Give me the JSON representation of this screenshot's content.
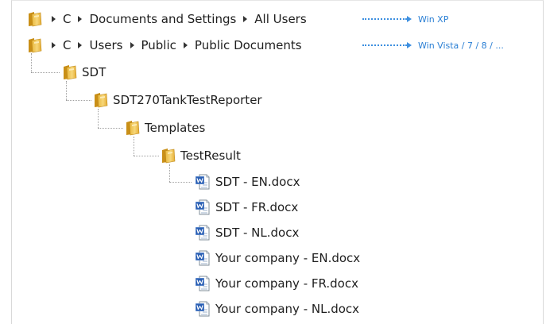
{
  "path_xp": {
    "segments": [
      "C",
      "Documents and Settings",
      "All Users"
    ],
    "os_label": "Win XP"
  },
  "path_vista": {
    "segments": [
      "C",
      "Users",
      "Public",
      "Public Documents"
    ],
    "os_label": "Win Vista / 7 / 8 / ..."
  },
  "tree": {
    "sdt": "SDT",
    "reporter": "SDT270TankTestReporter",
    "templates": "Templates",
    "testresult": "TestResult",
    "files": [
      "SDT - EN.docx",
      "SDT - FR.docx",
      "SDT - NL.docx",
      "Your company - EN.docx",
      "Your company - FR.docx",
      "Your company - NL.docx"
    ]
  },
  "colors": {
    "folder": "#f2c14a",
    "folder_dark": "#d49a1c",
    "accent": "#2a7fd4",
    "word_blue": "#2b5fb3"
  },
  "icons": {
    "folder": "folder-icon",
    "document": "word-document-icon",
    "arrow": "dotted-arrow-icon"
  }
}
